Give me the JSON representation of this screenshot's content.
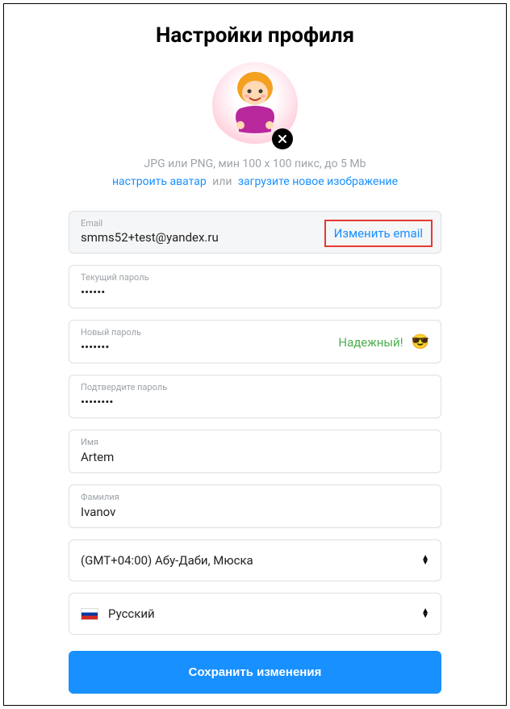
{
  "title": "Настройки профиля",
  "avatar": {
    "hint": "JPG или PNG, мин 100 x 100 пикс, до 5 Mb",
    "configure_link": "настроить аватар",
    "separator": "или",
    "upload_link": "загрузите новое изображение"
  },
  "fields": {
    "email": {
      "label": "Email",
      "value": "smms52+test@yandex.ru",
      "change_btn": "Изменить email"
    },
    "current_password": {
      "label": "Текущий пароль",
      "value": "••••••"
    },
    "new_password": {
      "label": "Новый пароль",
      "value": "•••••••",
      "strength": "Надежный!",
      "emoji": "😎"
    },
    "confirm_password": {
      "label": "Подтвердите пароль",
      "value": "••••••••"
    },
    "first_name": {
      "label": "Имя",
      "value": "Artem"
    },
    "last_name": {
      "label": "Фамилия",
      "value": "Ivanov"
    }
  },
  "timezone": {
    "value": "(GMT+04:00) Абу-Даби, Мюска"
  },
  "language": {
    "value": "Русский"
  },
  "save_btn": "Сохранить изменения"
}
